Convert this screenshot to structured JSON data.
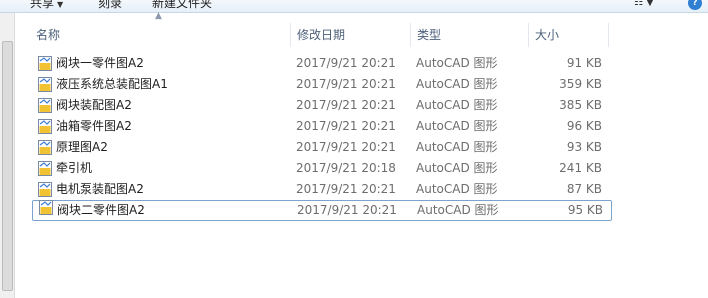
{
  "toolbar": {
    "share_label": "共享",
    "burn_label": "刻录",
    "new_folder_label": "新建文件夹"
  },
  "columns": {
    "name": "名称",
    "date": "修改日期",
    "type": "类型",
    "size": "大小"
  },
  "files": [
    {
      "name": "阀块一零件图A2",
      "date": "2017/9/21 20:21",
      "type": "AutoCAD 图形",
      "size": "91 KB"
    },
    {
      "name": "液压系统总装配图A1",
      "date": "2017/9/21 20:21",
      "type": "AutoCAD 图形",
      "size": "359 KB"
    },
    {
      "name": "阀块装配图A2",
      "date": "2017/9/21 20:21",
      "type": "AutoCAD 图形",
      "size": "385 KB"
    },
    {
      "name": "油箱零件图A2",
      "date": "2017/9/21 20:21",
      "type": "AutoCAD 图形",
      "size": "96 KB"
    },
    {
      "name": "原理图A2",
      "date": "2017/9/21 20:21",
      "type": "AutoCAD 图形",
      "size": "93 KB"
    },
    {
      "name": "牵引机",
      "date": "2017/9/21 20:18",
      "type": "AutoCAD 图形",
      "size": "241 KB"
    },
    {
      "name": "电机泵装配图A2",
      "date": "2017/9/21 20:21",
      "type": "AutoCAD 图形",
      "size": "87 KB"
    },
    {
      "name": "阀块二零件图A2",
      "date": "2017/9/21 20:21",
      "type": "AutoCAD 图形",
      "size": "95 KB"
    }
  ],
  "icons": {
    "file": "dwg-file-icon",
    "view": "view-options-icon",
    "help": "help-icon"
  }
}
